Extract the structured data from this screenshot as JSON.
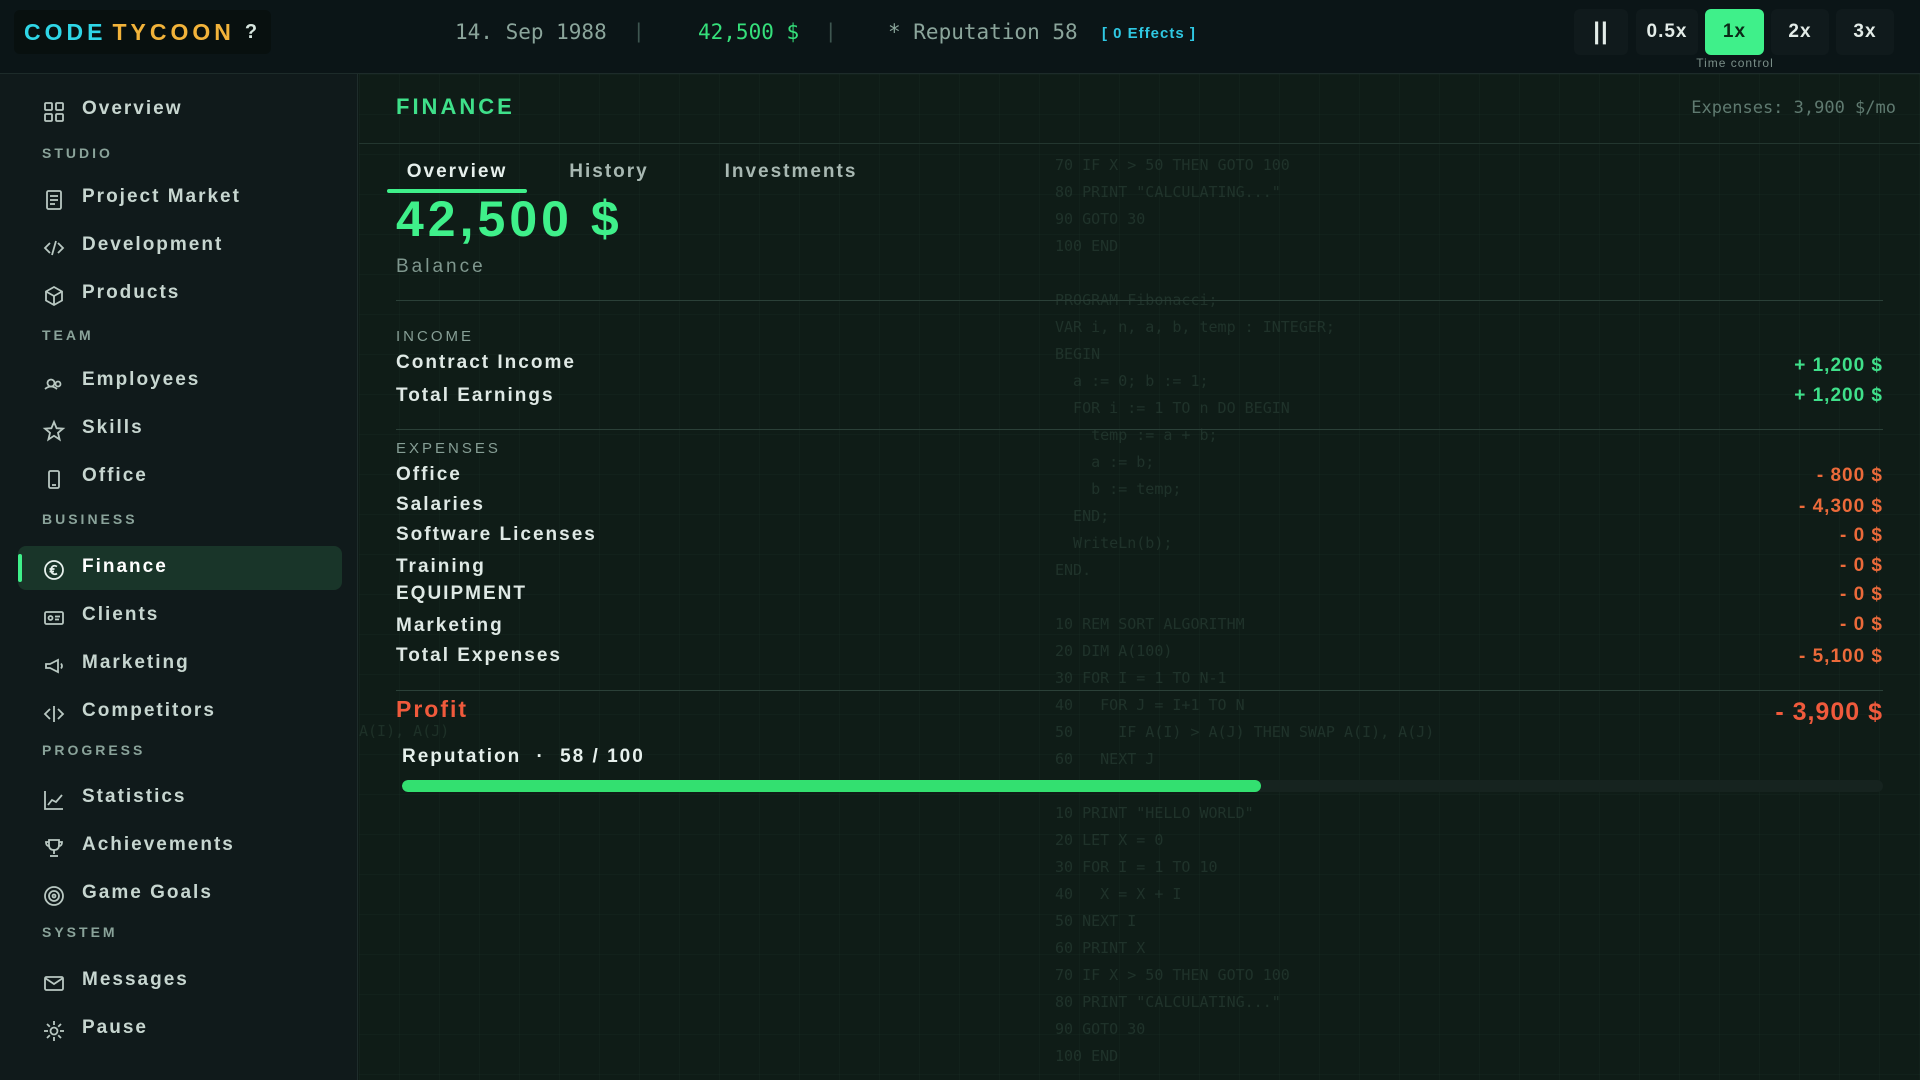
{
  "topbar": {
    "logo_part1": "CODE",
    "logo_part2": "TYCOON",
    "help": "?",
    "date": "14. Sep 1988",
    "separator": "|",
    "money": "42,500 $",
    "reputation": "* Reputation 58",
    "effects": "[ 0 Effects ]",
    "speeds": {
      "pause": "||",
      "s05": "0.5x",
      "s1": "1x",
      "s2": "2x",
      "s3": "3x"
    },
    "selected_speed": "1x",
    "time_control_label": "Time control"
  },
  "sidebar": {
    "overview": "Overview",
    "sections": {
      "studio": "STUDIO",
      "team": "TEAM",
      "business": "BUSINESS",
      "progress": "PROGRESS",
      "system": "SYSTEM"
    },
    "items": {
      "project_market": "Project Market",
      "development": "Development",
      "products": "Products",
      "employees": "Employees",
      "skills": "Skills",
      "office": "Office",
      "finance": "Finance",
      "clients": "Clients",
      "marketing": "Marketing",
      "competitors": "Competitors",
      "statistics": "Statistics",
      "achievements": "Achievements",
      "game_goals": "Game Goals",
      "messages": "Messages",
      "pause": "Pause"
    },
    "active": "Finance"
  },
  "main": {
    "title": "FINANCE",
    "expenses_summary": "Expenses: 3,900 $/mo",
    "tabs": {
      "overview": "Overview",
      "history": "History",
      "investments": "Investments"
    },
    "active_tab": "Overview",
    "balance_value": "42,500 $",
    "balance_label": "Balance",
    "income": {
      "section": "INCOME",
      "contract_label": "Contract Income",
      "contract_value": "+ 1,200 $",
      "total_label": "Total Earnings",
      "total_value": "+ 1,200 $"
    },
    "expenses": {
      "section": "EXPENSES",
      "office_label": "Office",
      "office_value": "- 800 $",
      "salaries_label": "Salaries",
      "salaries_value": "- 4,300 $",
      "licenses_label": "Software Licenses",
      "licenses_value": "- 0 $",
      "training_label": "Training",
      "training_value": "- 0 $",
      "equipment_label": "EQUIPMENT",
      "equipment_value": "- 0 $",
      "marketing_label": "Marketing",
      "marketing_value": "- 0 $",
      "total_label": "Total Expenses",
      "total_value": "- 5,100 $"
    },
    "profit_label": "Profit",
    "profit_value": "- 3,900 $",
    "reputation_label": "Reputation",
    "reputation_dot": "·",
    "reputation_value": "58 / 100",
    "reputation_fraction": 0.58,
    "background_code": "70 IF X > 50 THEN GOTO 100\n80 PRINT \"CALCULATING...\"\n90 GOTO 30\n100 END\n\nPROGRAM Fibonacci;\nVAR i, n, a, b, temp : INTEGER;\nBEGIN\n  a := 0; b := 1;\n  FOR i := 1 TO n DO BEGIN\n    temp := a + b;\n    a := b;\n    b := temp;\n  END;\n  WriteLn(b);\nEND.\n\n10 REM SORT ALGORITHM\n20 DIM A(100)\n30 FOR I = 1 TO N-1\n40   FOR J = I+1 TO N\n50     IF A(I) > A(J) THEN SWAP A(I), A(J)\n60   NEXT J\n\n10 PRINT \"HELLO WORLD\"\n20 LET X = 0\n30 FOR I = 1 TO 10\n40   X = X + I\n50 NEXT I\n60 PRINT X\n70 IF X > 50 THEN GOTO 100\n80 PRINT \"CALCULATING...\"\n90 GOTO 30\n100 END",
    "background_code_left": "A(I), A(J)"
  },
  "colors": {
    "accent": "#3ff08a",
    "negative": "#ec6a3a",
    "profit_negative": "#f05a3c",
    "logo_cyan": "#2fd6e6",
    "logo_gold": "#f2b33a"
  }
}
